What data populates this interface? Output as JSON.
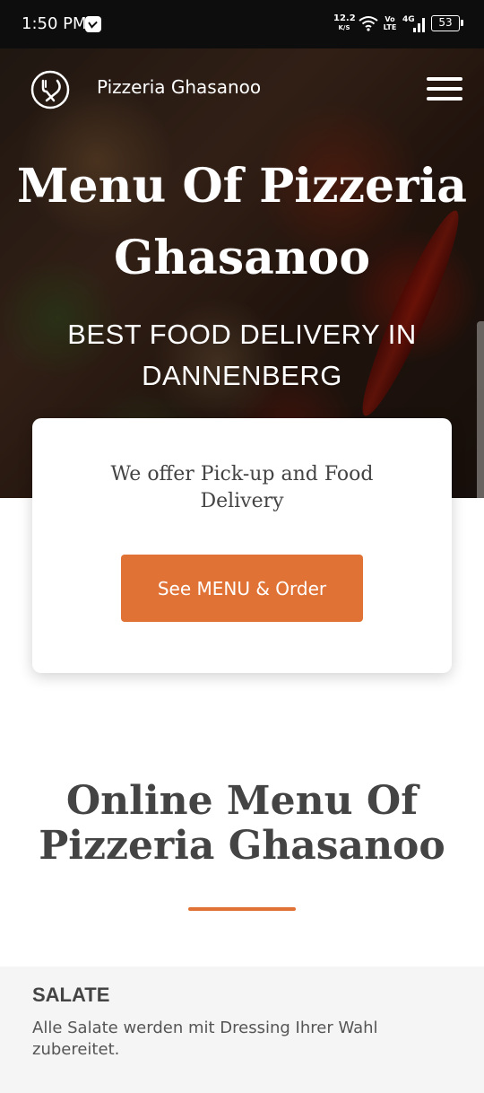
{
  "status_bar": {
    "time": "1:50 PM",
    "speed": "12.2",
    "speed_unit": "K/S",
    "volte_top": "Vo",
    "volte_bottom": "LTE",
    "network": "4G",
    "battery": "53"
  },
  "header": {
    "brand": "Pizzeria Ghasanoo",
    "logo_icon": "fork-knife-icon",
    "menu_icon": "hamburger-icon"
  },
  "hero": {
    "title": "Menu Of Pizzeria Ghasanoo",
    "subtitle": "BEST FOOD DELIVERY IN DANNENBERG"
  },
  "card": {
    "text": "We offer Pick-up and Food Delivery",
    "button_label": "See MENU & Order"
  },
  "section": {
    "title": "Online Menu Of Pizzeria Ghasanoo"
  },
  "category": {
    "title": "SALATE",
    "description": "Alle Salate werden mit Dressing Ihrer Wahl zubereitet."
  },
  "colors": {
    "accent": "#e07236",
    "text": "#444444",
    "category_bg": "#f5f5f5"
  }
}
